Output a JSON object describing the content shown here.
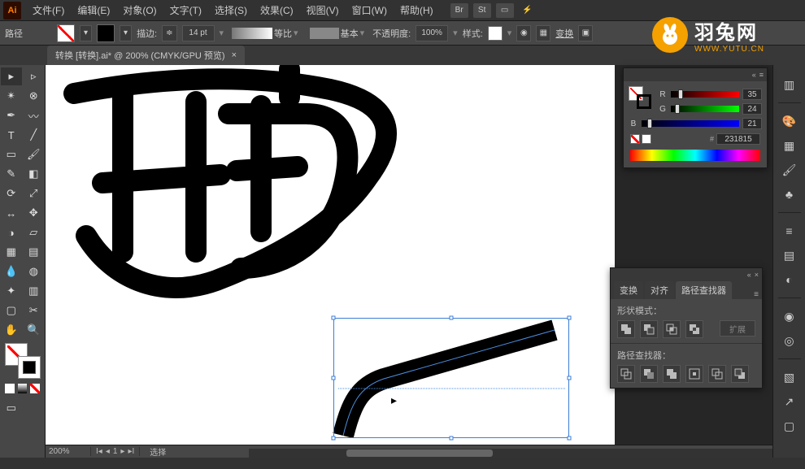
{
  "menus": {
    "file": "文件(F)",
    "edit": "编辑(E)",
    "object": "对象(O)",
    "text": "文字(T)",
    "select": "选择(S)",
    "effect": "效果(C)",
    "view": "视图(V)",
    "window": "窗口(W)",
    "help": "帮助(H)"
  },
  "menu_buttons": {
    "br": "Br",
    "st": "St"
  },
  "control": {
    "mode_label": "路径",
    "stroke_label": "描边:",
    "stroke_weight": "14 pt",
    "uniform": "等比",
    "basic": "基本",
    "opacity_label": "不透明度:",
    "opacity": "100%",
    "style_label": "样式:",
    "transform": "变换"
  },
  "document": {
    "tab": "转换  [转换].ai* @ 200% (CMYK/GPU 预览)"
  },
  "color_panel": {
    "r_label": "R",
    "r_value": "35",
    "g_label": "G",
    "g_value": "24",
    "b_label": "B",
    "b_value": "21",
    "hex": "231815"
  },
  "pathfinder": {
    "tab_transform": "变换",
    "tab_align": "对齐",
    "tab_pathfinder": "路径查找器",
    "shape_modes": "形状模式：",
    "expand": "扩展",
    "pathfinders": "路径查找器："
  },
  "status": {
    "zoom": "200%",
    "page": "1",
    "tool": "选择"
  },
  "watermark": {
    "name": "羽兔网",
    "url": "WWW.YUTU.CN"
  }
}
